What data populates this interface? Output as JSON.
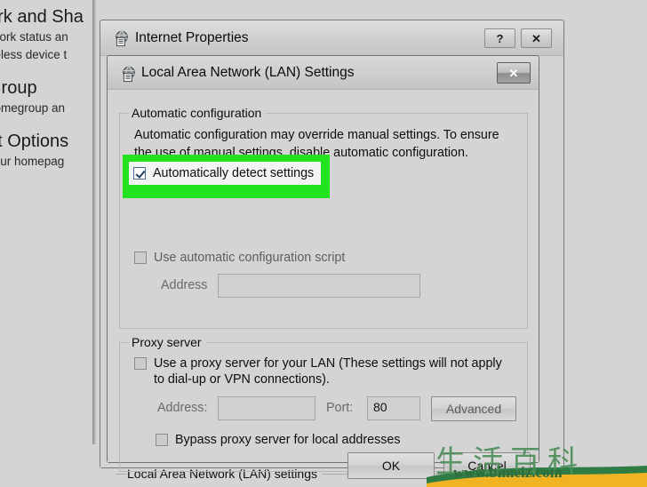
{
  "background": {
    "headings": [
      "ork and Sha",
      "Group",
      "et Options"
    ],
    "sublines": [
      "twork status an",
      "ireless device t",
      "homegroup an",
      "your homepag"
    ],
    "status_label": "Local Area Network (LAN) settings"
  },
  "internet_properties": {
    "title": "Internet Properties",
    "icon": "internet-properties-icon",
    "help_glyph": "?",
    "close_glyph": "✕"
  },
  "lan_settings": {
    "title": "Local Area Network (LAN) Settings",
    "icon": "lan-settings-icon",
    "close_glyph": "✕",
    "automatic_configuration": {
      "legend": "Automatic configuration",
      "description": "Automatic configuration may override manual settings.  To ensure the use of manual settings, disable automatic configuration.",
      "auto_detect": {
        "label": "Automatically detect settings",
        "checked": true,
        "highlighted": true
      },
      "use_script": {
        "label": "Use automatic configuration script",
        "checked": false
      },
      "address_label": "Address",
      "address_value": ""
    },
    "proxy_server": {
      "legend": "Proxy server",
      "use_proxy": {
        "label": "Use a proxy server for your LAN (These settings will not apply to dial-up or VPN connections).",
        "checked": false
      },
      "address_label": "Address:",
      "address_value": "",
      "port_label": "Port:",
      "port_value": "80",
      "advanced_label": "Advanced",
      "bypass": {
        "label": "Bypass proxy server for local addresses",
        "checked": false
      }
    },
    "buttons": {
      "ok": "OK",
      "cancel": "Cancel"
    }
  },
  "watermark": {
    "cjk": "生活百科",
    "url": "www.bimeiz.com"
  },
  "colors": {
    "highlight_green": "#22e31e",
    "window_face": "#d4d4d4",
    "watermark_green": "#2e6b3c"
  }
}
